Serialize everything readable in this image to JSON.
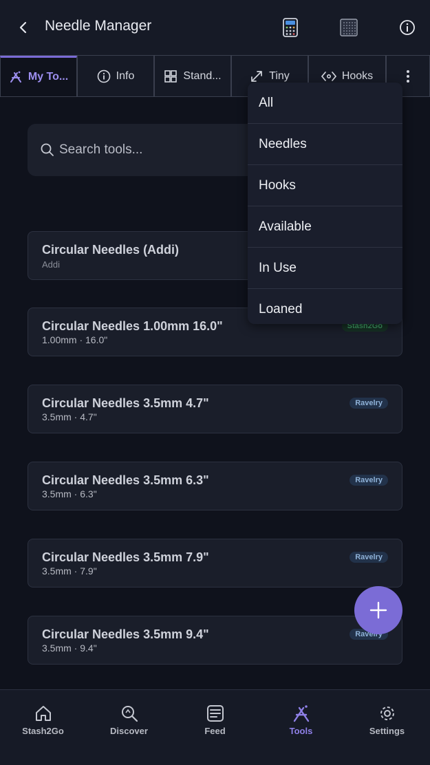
{
  "header": {
    "title": "Needle Manager",
    "back_icon": "chevron-left-icon",
    "icons": [
      "calculator-icon",
      "grid-icon",
      "info-icon"
    ]
  },
  "tabs": [
    {
      "label": "My To...",
      "icon": "tools-icon",
      "active": true
    },
    {
      "label": "Info",
      "icon": "info-icon",
      "active": false
    },
    {
      "label": "Stand...",
      "icon": "grid-icon",
      "active": false
    },
    {
      "label": "Tiny",
      "icon": "expand-icon",
      "active": false
    },
    {
      "label": "Hooks",
      "icon": "hook-icon",
      "active": false
    }
  ],
  "search": {
    "placeholder": "Search tools..."
  },
  "filter_menu": {
    "items": [
      "All",
      "Needles",
      "Hooks",
      "Available",
      "In Use",
      "Loaned"
    ]
  },
  "tools": [
    {
      "name": "Circular Needles (Addi)",
      "detail": "Addi",
      "badge": ""
    },
    {
      "name": "Circular Needles 1.00mm 16.0\"",
      "detail": "1.00mm · 16.0\"",
      "badge": "Stash2Go"
    },
    {
      "name": "Circular Needles 3.5mm 4.7\"",
      "detail": "3.5mm · 4.7\"",
      "badge": "Ravelry"
    },
    {
      "name": "Circular Needles 3.5mm 6.3\"",
      "detail": "3.5mm · 6.3\"",
      "badge": "Ravelry"
    },
    {
      "name": "Circular Needles 3.5mm 7.9\"",
      "detail": "3.5mm · 7.9\"",
      "badge": "Ravelry"
    },
    {
      "name": "Circular Needles 3.5mm 9.4\"",
      "detail": "3.5mm · 9.4\"",
      "badge": "Ravelry"
    }
  ],
  "bottom_nav": [
    {
      "label": "Stash2Go",
      "icon": "home-icon",
      "active": false
    },
    {
      "label": "Discover",
      "icon": "search-icon",
      "active": false
    },
    {
      "label": "Feed",
      "icon": "feed-icon",
      "active": false
    },
    {
      "label": "Tools",
      "icon": "tools-icon",
      "active": true
    },
    {
      "label": "Settings",
      "icon": "gear-icon",
      "active": false
    }
  ],
  "colors": {
    "background": "#0f121c",
    "surface": "#1a1e2a",
    "accent": "#7b6cd6",
    "ravelry_badge": "#8fb2d8",
    "stash_badge": "#3f9c66"
  }
}
